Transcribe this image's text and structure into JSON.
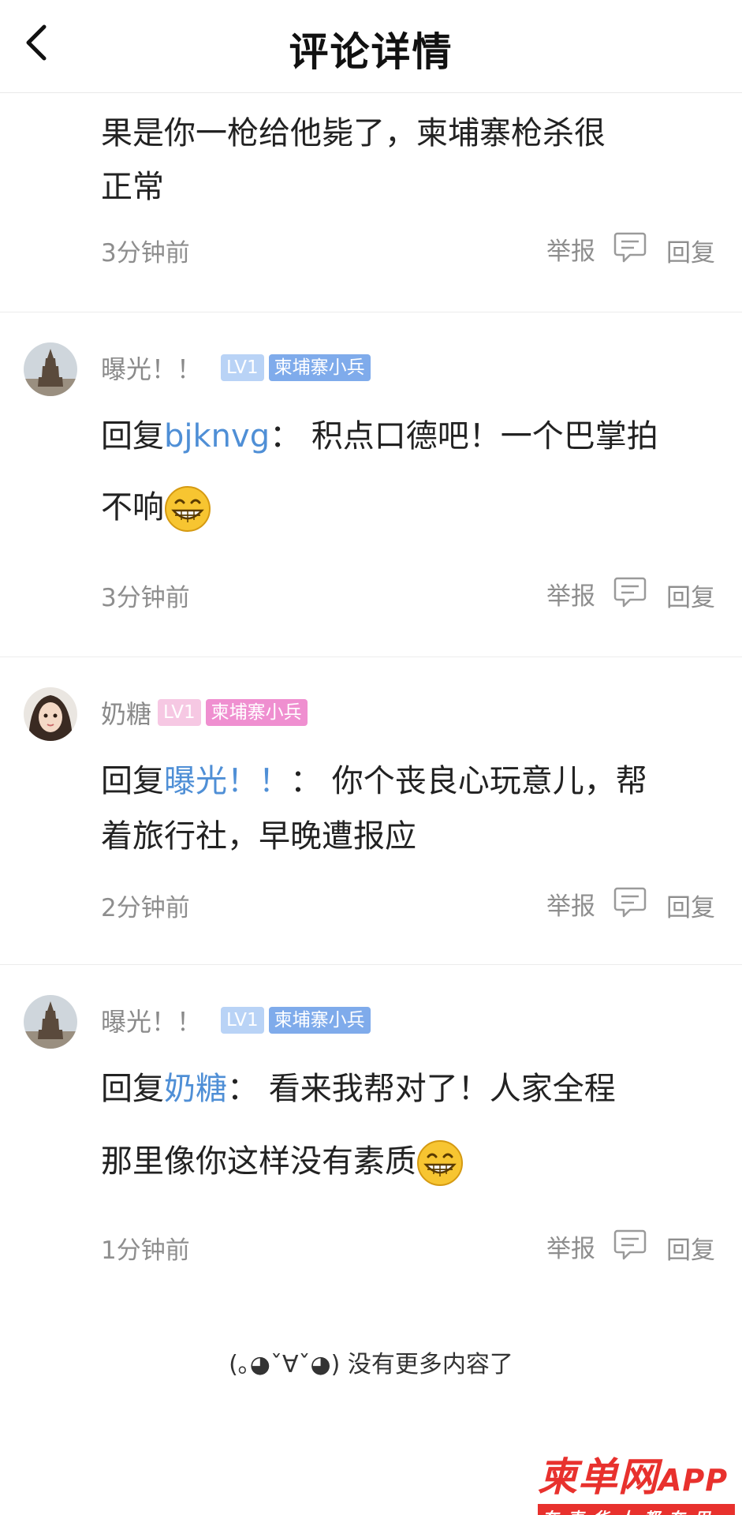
{
  "header": {
    "title": "评论详情"
  },
  "comments": [
    {
      "content_line1": "果是你一枪给他毙了，柬埔寨枪杀很",
      "content_line2": "正常",
      "time": "3分钟前",
      "report": "举报",
      "reply": "回复"
    },
    {
      "username": "曝光！！",
      "level": "LV1",
      "title": "柬埔寨小兵",
      "reply_prefix": "回复",
      "reply_to": "bjknvg",
      "colon": "：",
      "content_line1": "积点口德吧！一个巴掌拍",
      "content_line2": "不响",
      "emoji": "grin-emoji",
      "time": "3分钟前",
      "report": "举报",
      "reply": "回复"
    },
    {
      "username": "奶糖",
      "level": "LV1",
      "title": "柬埔寨小兵",
      "reply_prefix": "回复",
      "reply_to": "曝光！！",
      "colon": "：",
      "content_line1": "你个丧良心玩意儿，帮",
      "content_line2": "着旅行社，早晚遭报应",
      "time": "2分钟前",
      "report": "举报",
      "reply": "回复"
    },
    {
      "username": "曝光！！",
      "level": "LV1",
      "title": "柬埔寨小兵",
      "reply_prefix": "回复",
      "reply_to": "奶糖",
      "colon": "：",
      "content_line1": "看来我帮对了！人家全程",
      "content_line2": "那里像你这样没有素质",
      "emoji": "grin-emoji",
      "time": "1分钟前",
      "report": "举报",
      "reply": "回复"
    }
  ],
  "footer": {
    "end_text": "(｡◕ˇ∀ˇ◕) 没有更多内容了"
  },
  "watermark": {
    "brand": "柬单网",
    "app": "APP",
    "slogan": "在柬华人都在用"
  },
  "colors": {
    "reply_link": "#4f8fd6",
    "badge_blue": "#7fabeb",
    "badge_pink": "#ef8fd0",
    "brand_red": "#e8312d"
  }
}
